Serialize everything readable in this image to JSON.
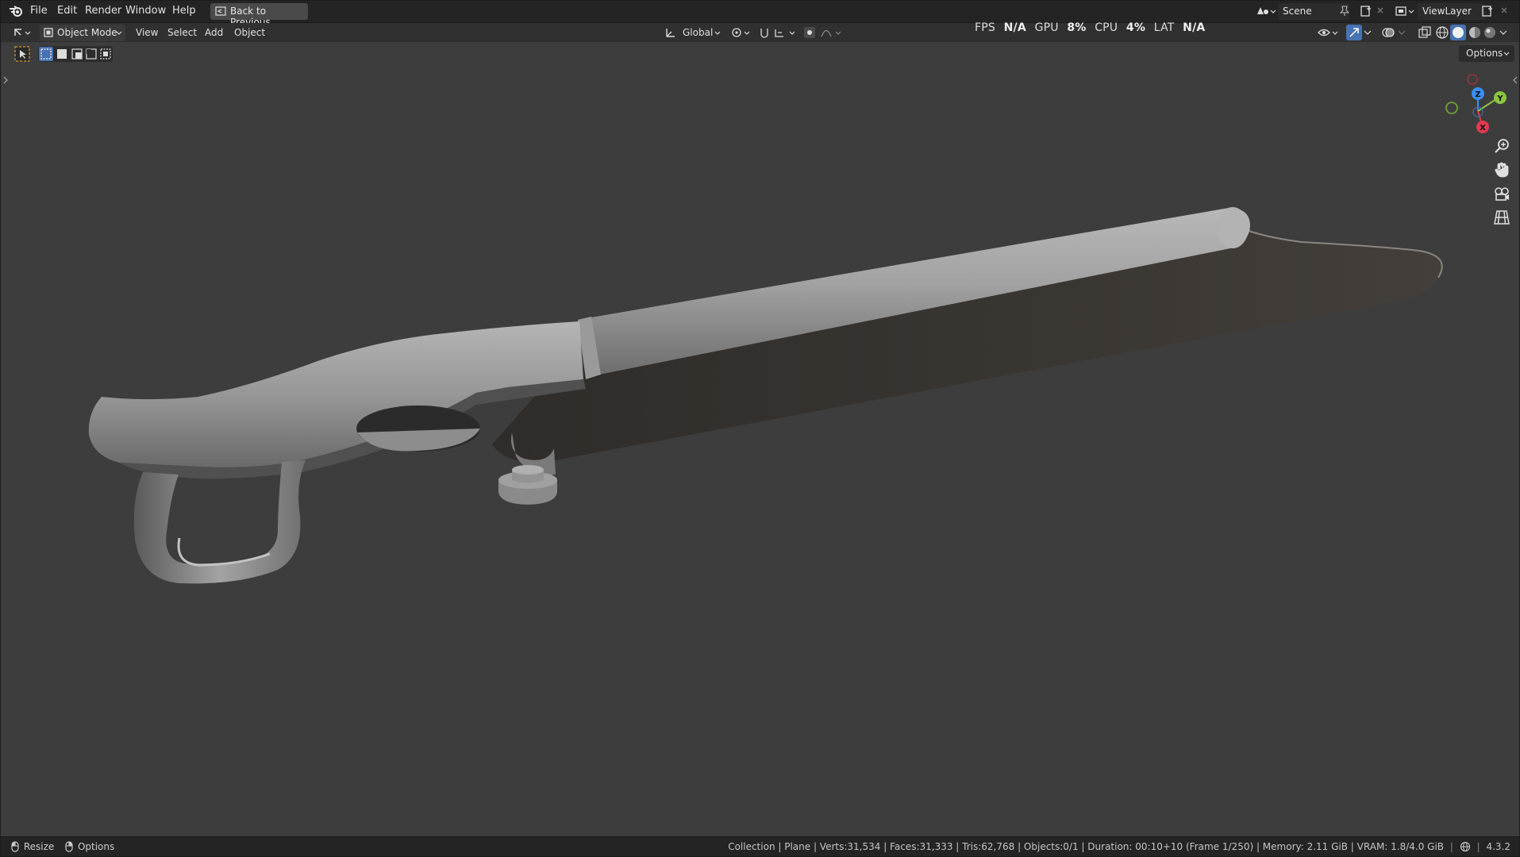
{
  "menubar": {
    "items": [
      "File",
      "Edit",
      "Render",
      "Window",
      "Help"
    ],
    "back_button": "Back to Previous",
    "scene_label": "Scene",
    "viewlayer_label": "ViewLayer"
  },
  "header": {
    "mode": "Object Mode",
    "menus": [
      "View",
      "Select",
      "Add",
      "Object"
    ],
    "transform_orientation": "Global",
    "options_label": "Options"
  },
  "stats": {
    "fps_label": "FPS",
    "fps_value": "N/A",
    "gpu_label": "GPU",
    "gpu_value": "8%",
    "cpu_label": "CPU",
    "cpu_value": "4%",
    "lat_label": "LAT",
    "lat_value": "N/A"
  },
  "gizmo": {
    "z_label": "Z",
    "y_label": "Y",
    "x_label": "X",
    "colors": {
      "x": "#e03a4f",
      "y": "#8cc63f",
      "z": "#3a8ff0"
    }
  },
  "statusbar": {
    "left_resize": "Resize",
    "left_options": "Options",
    "info": "Collection | Plane | Verts:31,534 | Faces:31,333 | Tris:62,768 | Objects:0/1 | Duration: 00:10+10 (Frame 1/250) | Memory: 2.11 GiB | VRAM: 1.8/4.0 GiB",
    "version": "4.3.2"
  }
}
